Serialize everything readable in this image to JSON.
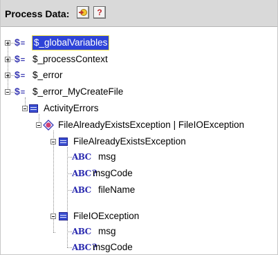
{
  "header": {
    "title": "Process Data:"
  },
  "tree": {
    "globalVariables": {
      "label": "$_globalVariables"
    },
    "processContext": {
      "label": "$_processContext"
    },
    "error": {
      "label": "$_error"
    },
    "errorMyCreateFile": {
      "label": "$_error_MyCreateFile"
    },
    "activityErrors": {
      "label": "ActivityErrors"
    },
    "choice": {
      "label": "FileAlreadyExistsException | FileIOException"
    },
    "fileAlreadyExists": {
      "label": "FileAlreadyExistsException",
      "children": [
        "msg",
        "msgCode",
        "fileName"
      ]
    },
    "fileIO": {
      "label": "FileIOException",
      "children": [
        "msg",
        "msgCode"
      ]
    }
  },
  "icons": {
    "header_buttons": [
      "map-icon",
      "help-icon"
    ],
    "root_icon": "dollar-variable-icon",
    "group_icon": "struct-icon",
    "choice_icon": "choice-icon",
    "leaf_icon": "string-type-icon",
    "optional_leaf_icon": "optional-string-type-icon"
  },
  "help_glyph": "?",
  "variable_glyph": "$=",
  "string_glyph": "ABC",
  "optional_glyph": "?"
}
